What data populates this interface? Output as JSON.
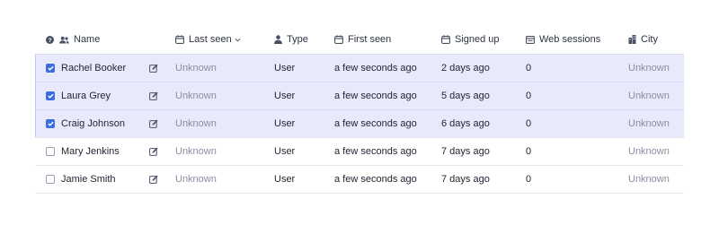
{
  "header": {
    "name_label": "Name",
    "last_seen_label": "Last seen",
    "type_label": "Type",
    "first_seen_label": "First seen",
    "signed_up_label": "Signed up",
    "web_sessions_label": "Web sessions",
    "city_label": "City"
  },
  "colors": {
    "selected_row": "#e8eafb",
    "checkbox_checked": "#3b6fe0",
    "muted_text": "#8a8fa0"
  },
  "rows": [
    {
      "selected": true,
      "name": "Rachel Booker",
      "last_seen": "Unknown",
      "type": "User",
      "first_seen": "a few seconds ago",
      "signed_up": "2 days ago",
      "web_sessions": "0",
      "city": "Unknown"
    },
    {
      "selected": true,
      "name": "Laura Grey",
      "last_seen": "Unknown",
      "type": "User",
      "first_seen": "a few seconds ago",
      "signed_up": "5 days ago",
      "web_sessions": "0",
      "city": "Unknown"
    },
    {
      "selected": true,
      "name": "Craig Johnson",
      "last_seen": "Unknown",
      "type": "User",
      "first_seen": "a few seconds ago",
      "signed_up": "6 days ago",
      "web_sessions": "0",
      "city": "Unknown"
    },
    {
      "selected": false,
      "name": "Mary Jenkins",
      "last_seen": "Unknown",
      "type": "User",
      "first_seen": "a few seconds ago",
      "signed_up": "7 days ago",
      "web_sessions": "0",
      "city": "Unknown"
    },
    {
      "selected": false,
      "name": "Jamie Smith",
      "last_seen": "Unknown",
      "type": "User",
      "first_seen": "a few seconds ago",
      "signed_up": "7 days ago",
      "web_sessions": "0",
      "city": "Unknown"
    }
  ]
}
